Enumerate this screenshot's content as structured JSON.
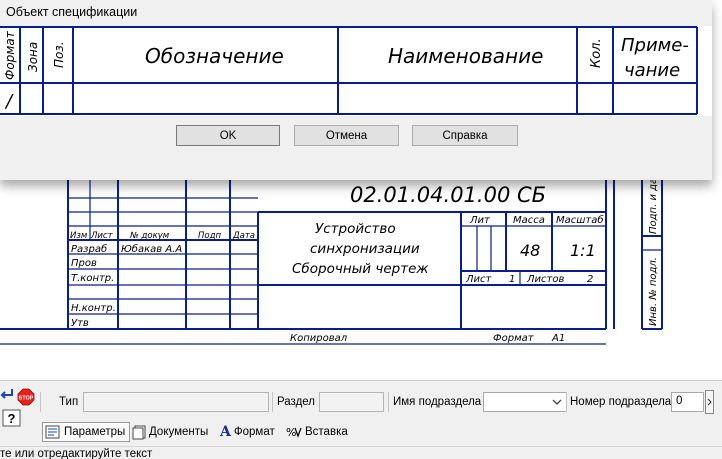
{
  "dialog": {
    "title": "Объект спецификации",
    "columns": {
      "format": "Формат",
      "zone": "Зона",
      "pos": "Поз.",
      "designation": "Обозначение",
      "name": "Наименование",
      "qty": "Кол.",
      "note_line1": "Приме-",
      "note_line2": "чание"
    },
    "row_format_value": "/",
    "buttons": {
      "ok": "OK",
      "cancel": "Отмена",
      "help": "Справка"
    }
  },
  "drawing": {
    "doc_code": "02.01.04.01.00 СБ",
    "title_line1": "Устройство",
    "title_line2": "синхронизации",
    "title_line3": "Сборочный чертеж",
    "head": {
      "izm": "Изм",
      "list": "Лист",
      "ndoc": "№ докум",
      "podp": "Подп",
      "data": "Дата"
    },
    "roles": {
      "razrab": "Разраб",
      "prov": "Пров",
      "tkontr": "Т.контр.",
      "nkontr": "Н.контр.",
      "utv": "Утв"
    },
    "developer": "Юбакав А.А",
    "lit": "Лит",
    "massa": "Масса",
    "masshtab": "Масштаб",
    "mass_value": "48",
    "scale_value": "1:1",
    "sheet_label": "Лист",
    "sheet_value": "1",
    "sheets_label": "Листов",
    "sheets_value": "2",
    "copied": "Копировал",
    "format_label": "Формат",
    "format_value": "A1",
    "side_top": "Подп. и дата",
    "side_bottom": "Инв. № подл."
  },
  "panel": {
    "stop_label": "STOP",
    "help_glyph": "?",
    "type_label": "Тип",
    "type_value": "",
    "section_label": "Раздел",
    "section_value": "",
    "subsection_label": "Имя подраздела",
    "subsection_value": "",
    "subsection_num_label": "Номер подраздела",
    "subsection_num_value": "0",
    "tabs": {
      "params": "Параметры",
      "docs": "Документы",
      "format": "Формат",
      "insert": "Вставка"
    }
  },
  "status": {
    "text": "те или отредактируйте текст"
  },
  "colors": {
    "line_blue": "#0b1e8f",
    "stop_red": "#e8211d"
  }
}
